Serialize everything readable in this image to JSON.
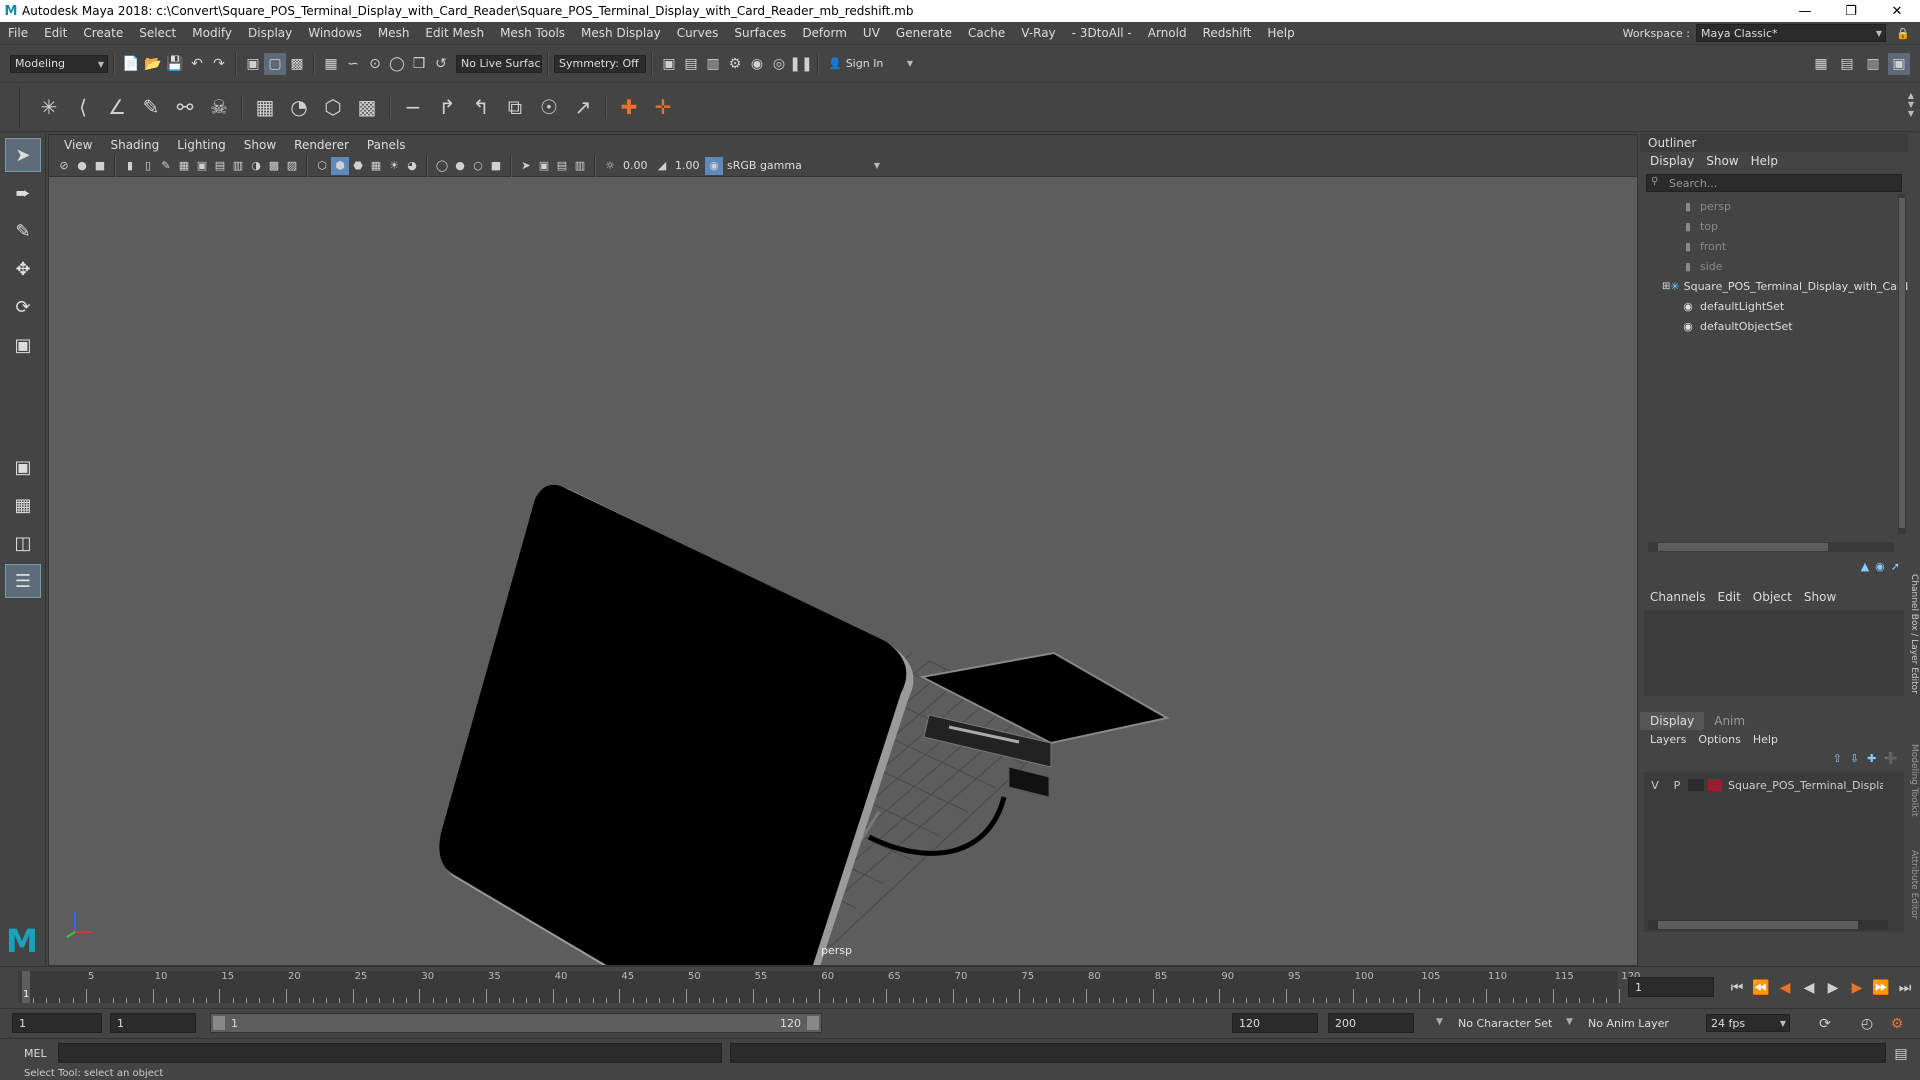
{
  "title": "Autodesk Maya 2018: c:\\Convert\\Square_POS_Terminal_Display_with_Card_Reader\\Square_POS_Terminal_Display_with_Card_Reader_mb_redshift.mb",
  "menus": [
    "File",
    "Edit",
    "Create",
    "Select",
    "Modify",
    "Display",
    "Windows",
    "Mesh",
    "Edit Mesh",
    "Mesh Tools",
    "Mesh Display",
    "Curves",
    "Surfaces",
    "Deform",
    "UV",
    "Generate",
    "Cache",
    "V-Ray",
    "- 3DtoAll -",
    "Arnold",
    "Redshift",
    "Help"
  ],
  "workspace": {
    "label": "Workspace :",
    "value": "Maya Classic*"
  },
  "status": {
    "mode": "Modeling",
    "live_surface": "No Live Surface",
    "symmetry": "Symmetry: Off",
    "sign_in": "Sign In"
  },
  "panel": {
    "menus": [
      "View",
      "Shading",
      "Lighting",
      "Show",
      "Renderer",
      "Panels"
    ],
    "exposure": "0.00",
    "gamma": "1.00",
    "colorspace": "sRGB gamma",
    "camera": "persp"
  },
  "outliner": {
    "title": "Outliner",
    "menus": [
      "Display",
      "Show",
      "Help"
    ],
    "search_placeholder": "Search...",
    "items": [
      {
        "label": "persp",
        "icon": "camera-icon",
        "dim": true
      },
      {
        "label": "top",
        "icon": "camera-icon",
        "dim": true
      },
      {
        "label": "front",
        "icon": "camera-icon",
        "dim": true
      },
      {
        "label": "side",
        "icon": "camera-icon",
        "dim": true
      },
      {
        "label": "Square_POS_Terminal_Display_with_Card_Reader",
        "icon": "group-icon",
        "dim": false
      },
      {
        "label": "defaultLightSet",
        "icon": "set-icon",
        "dim": false
      },
      {
        "label": "defaultObjectSet",
        "icon": "set-icon",
        "dim": false
      }
    ]
  },
  "channelbox": {
    "menus": [
      "Channels",
      "Edit",
      "Object",
      "Show"
    ],
    "side_tab": "Channel Box / Layer Editor"
  },
  "layers": {
    "tabs": [
      "Display",
      "Anim"
    ],
    "menus": [
      "Layers",
      "Options",
      "Help"
    ],
    "row": {
      "v": "V",
      "p": "P",
      "name": "Square_POS_Terminal_Display_with_Card_Reader",
      "color": "#9b1b30"
    }
  },
  "side_tabs": [
    "Modeling Toolkit",
    "Attribute Editor"
  ],
  "timeline": {
    "ticks": [
      "5",
      "10",
      "15",
      "20",
      "25",
      "30",
      "35",
      "40",
      "45",
      "50",
      "55",
      "60",
      "65",
      "70",
      "75",
      "80",
      "85",
      "90",
      "95",
      "100",
      "105",
      "110",
      "115",
      "120"
    ],
    "current": "1",
    "current_frame_field": "1"
  },
  "range": {
    "start": "1",
    "playback_start": "1",
    "slider_start": "1",
    "slider_end": "120",
    "playback_end": "120",
    "end": "200",
    "character_set": "No Character Set",
    "anim_layer": "No Anim Layer",
    "fps": "24 fps"
  },
  "cmd": {
    "label": "MEL"
  },
  "help": "Select Tool: select an object"
}
